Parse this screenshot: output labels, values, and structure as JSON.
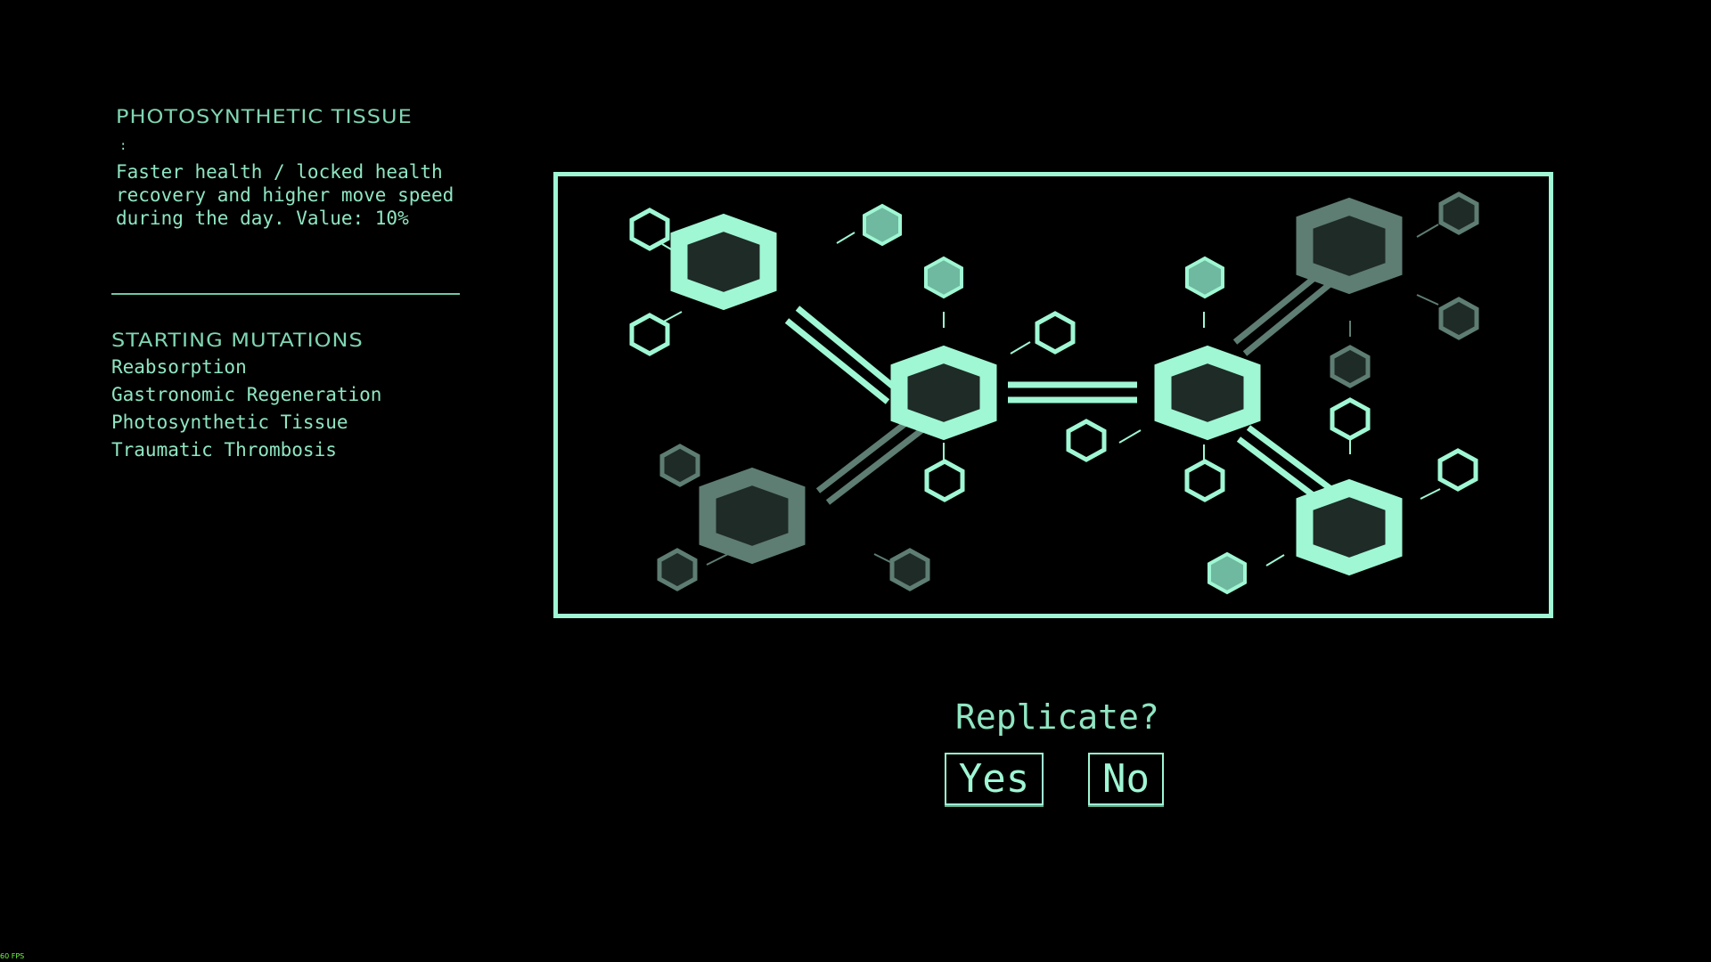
{
  "mutation": {
    "title": "PHOTOSYNTHETIC TISSUE",
    "colon": ":",
    "description": "Faster health / locked health recovery and higher move speed during the day. Value: 10%"
  },
  "starting_mutations": {
    "title": "STARTING MUTATIONS",
    "items": [
      "Reabsorption",
      "Gastronomic Regeneration",
      "Photosynthetic Tissue",
      "Traumatic Thrombosis"
    ]
  },
  "prompt": {
    "question": "Replicate?",
    "yes_label": "Yes",
    "no_label": "No"
  },
  "fps": "60 FPS",
  "colors": {
    "accent": "#9ff7d4",
    "text": "#8fe6c2",
    "dim": "#5e7d73",
    "hex_fill": "#1f2b27",
    "fps": "#6bff3f"
  }
}
